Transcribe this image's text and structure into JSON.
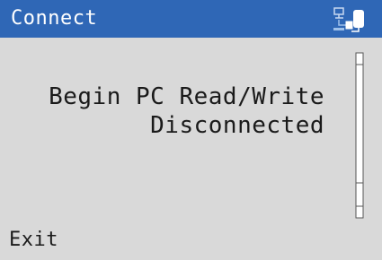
{
  "titlebar": {
    "title": "Connect",
    "icon": "pc-connection-icon",
    "color": "#2f67b6"
  },
  "main": {
    "line1": "Begin PC Read/Write",
    "line2": "Disconnected"
  },
  "softkeys": {
    "exit_label": "Exit"
  },
  "scrollbar": {
    "visible": true
  },
  "colors": {
    "background": "#d9d9d9",
    "text": "#1a1a1a"
  }
}
